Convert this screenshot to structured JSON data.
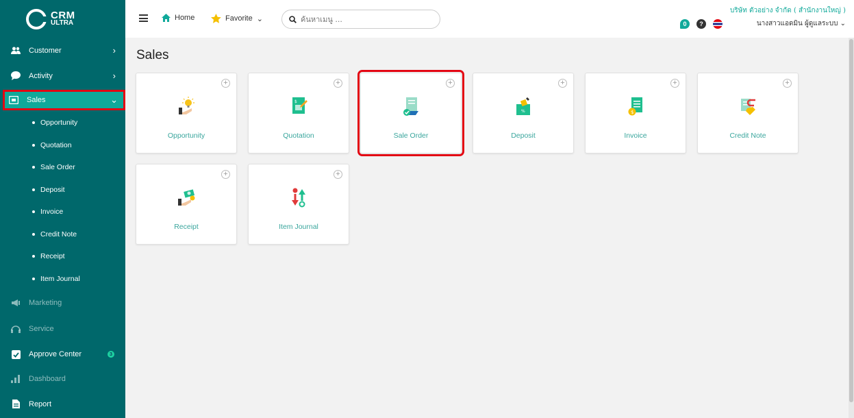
{
  "logo": {
    "line1": "CRM",
    "line2": "ULTRA"
  },
  "sidebar": {
    "items": [
      {
        "label": "Customer"
      },
      {
        "label": "Activity"
      },
      {
        "label": "Sales"
      },
      {
        "label": "Marketing"
      },
      {
        "label": "Service"
      },
      {
        "label": "Approve Center",
        "badge": "3"
      },
      {
        "label": "Dashboard"
      },
      {
        "label": "Report"
      }
    ],
    "sales_sub": [
      "Opportunity",
      "Quotation",
      "Sale Order",
      "Deposit",
      "Invoice",
      "Credit Note",
      "Receipt",
      "Item Journal"
    ]
  },
  "topbar": {
    "home": "Home",
    "favorite": "Favorite",
    "search_placeholder": "ค้นหาเมนู ...",
    "company": "บริษัท ตัวอย่าง จำกัด ( สำนักงานใหญ่ )",
    "user": "นางสาวแอดมิน ผู้ดูแลระบบ",
    "notif_count": "0"
  },
  "page": {
    "title": "Sales"
  },
  "cards": [
    "Opportunity",
    "Quotation",
    "Sale Order",
    "Deposit",
    "Invoice",
    "Credit Note",
    "Receipt",
    "Item Journal"
  ],
  "colors": {
    "sidebar": "#00686b",
    "accent": "#10a99a",
    "highlight": "#e30613"
  }
}
